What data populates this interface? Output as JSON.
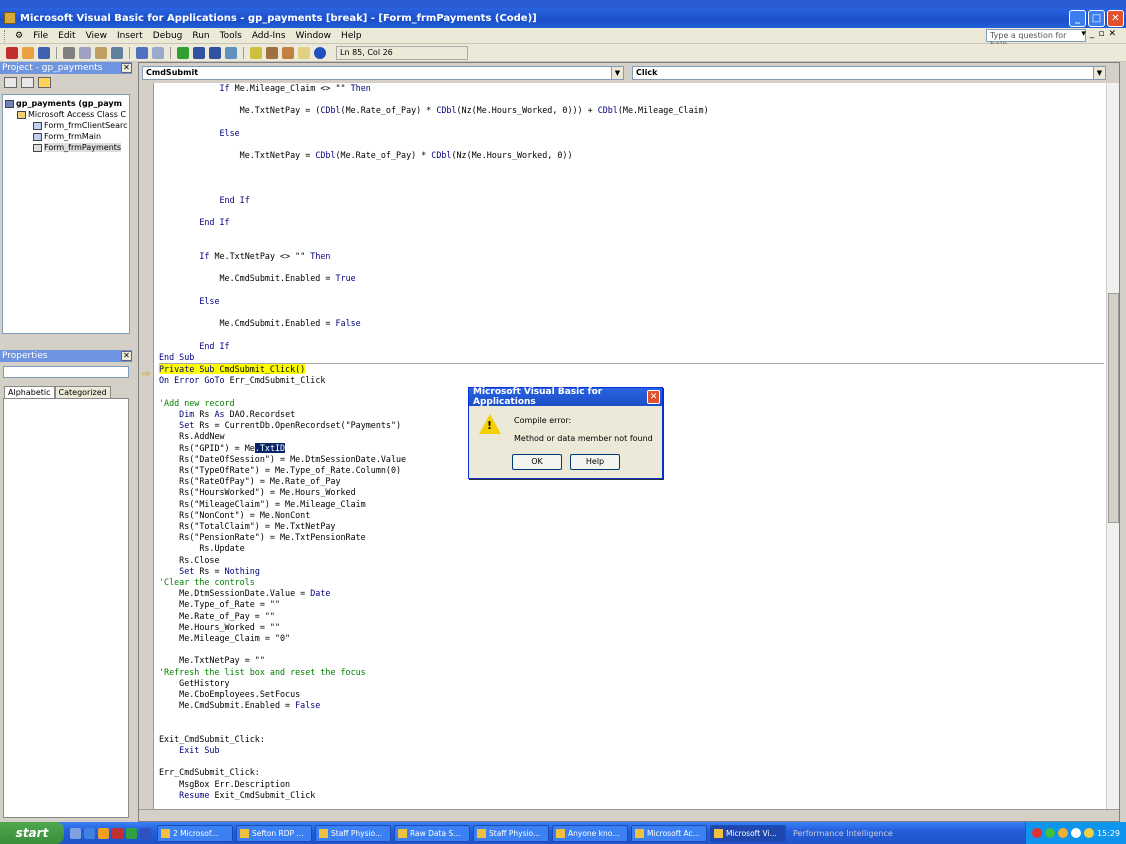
{
  "window": {
    "title": "Microsoft Visual Basic for Applications - gp_payments [break] - [Form_frmPayments (Code)]"
  },
  "menu": [
    "File",
    "Edit",
    "View",
    "Insert",
    "Debug",
    "Run",
    "Tools",
    "Add-Ins",
    "Window",
    "Help"
  ],
  "help_box": "Type a question for help",
  "toolbar": {
    "position": "Ln 85, Col 26"
  },
  "project": {
    "title": "Project - gp_payments",
    "tree": [
      {
        "label": "gp_payments (gp_paym",
        "bold": true,
        "type": "proj"
      },
      {
        "label": "Microsoft Access Class C",
        "type": "folder"
      },
      {
        "label": "Form_frmClientSearc",
        "type": "form"
      },
      {
        "label": "Form_frmMain",
        "type": "form"
      },
      {
        "label": "Form_frmPayments",
        "type": "form",
        "selected": true
      }
    ]
  },
  "properties": {
    "title": "Properties",
    "tabs": [
      "Alphabetic",
      "Categorized"
    ]
  },
  "code_window": {
    "object_combo": "CmdSubmit",
    "proc_combo": "Click"
  },
  "dialog": {
    "title": "Microsoft Visual Basic for Applications",
    "message1": "Compile error:",
    "message2": "Method or data member not found",
    "ok": "OK",
    "help": "Help"
  },
  "taskbar": {
    "start": "start",
    "tasks": [
      "2 Microsof...",
      "Sefton RDP ...",
      "Staff Physio...",
      "Raw Data S...",
      "Staff Physio...",
      "Anyone kno...",
      "Microsoft Ac...",
      "Microsoft Vi..."
    ],
    "perf": "Performance Intelligence",
    "clock": "15:29"
  },
  "colors": {
    "keyword": "#00007f",
    "comment": "#007f00",
    "highlight": "#ffff00",
    "titlebar": "#2a63e0"
  }
}
